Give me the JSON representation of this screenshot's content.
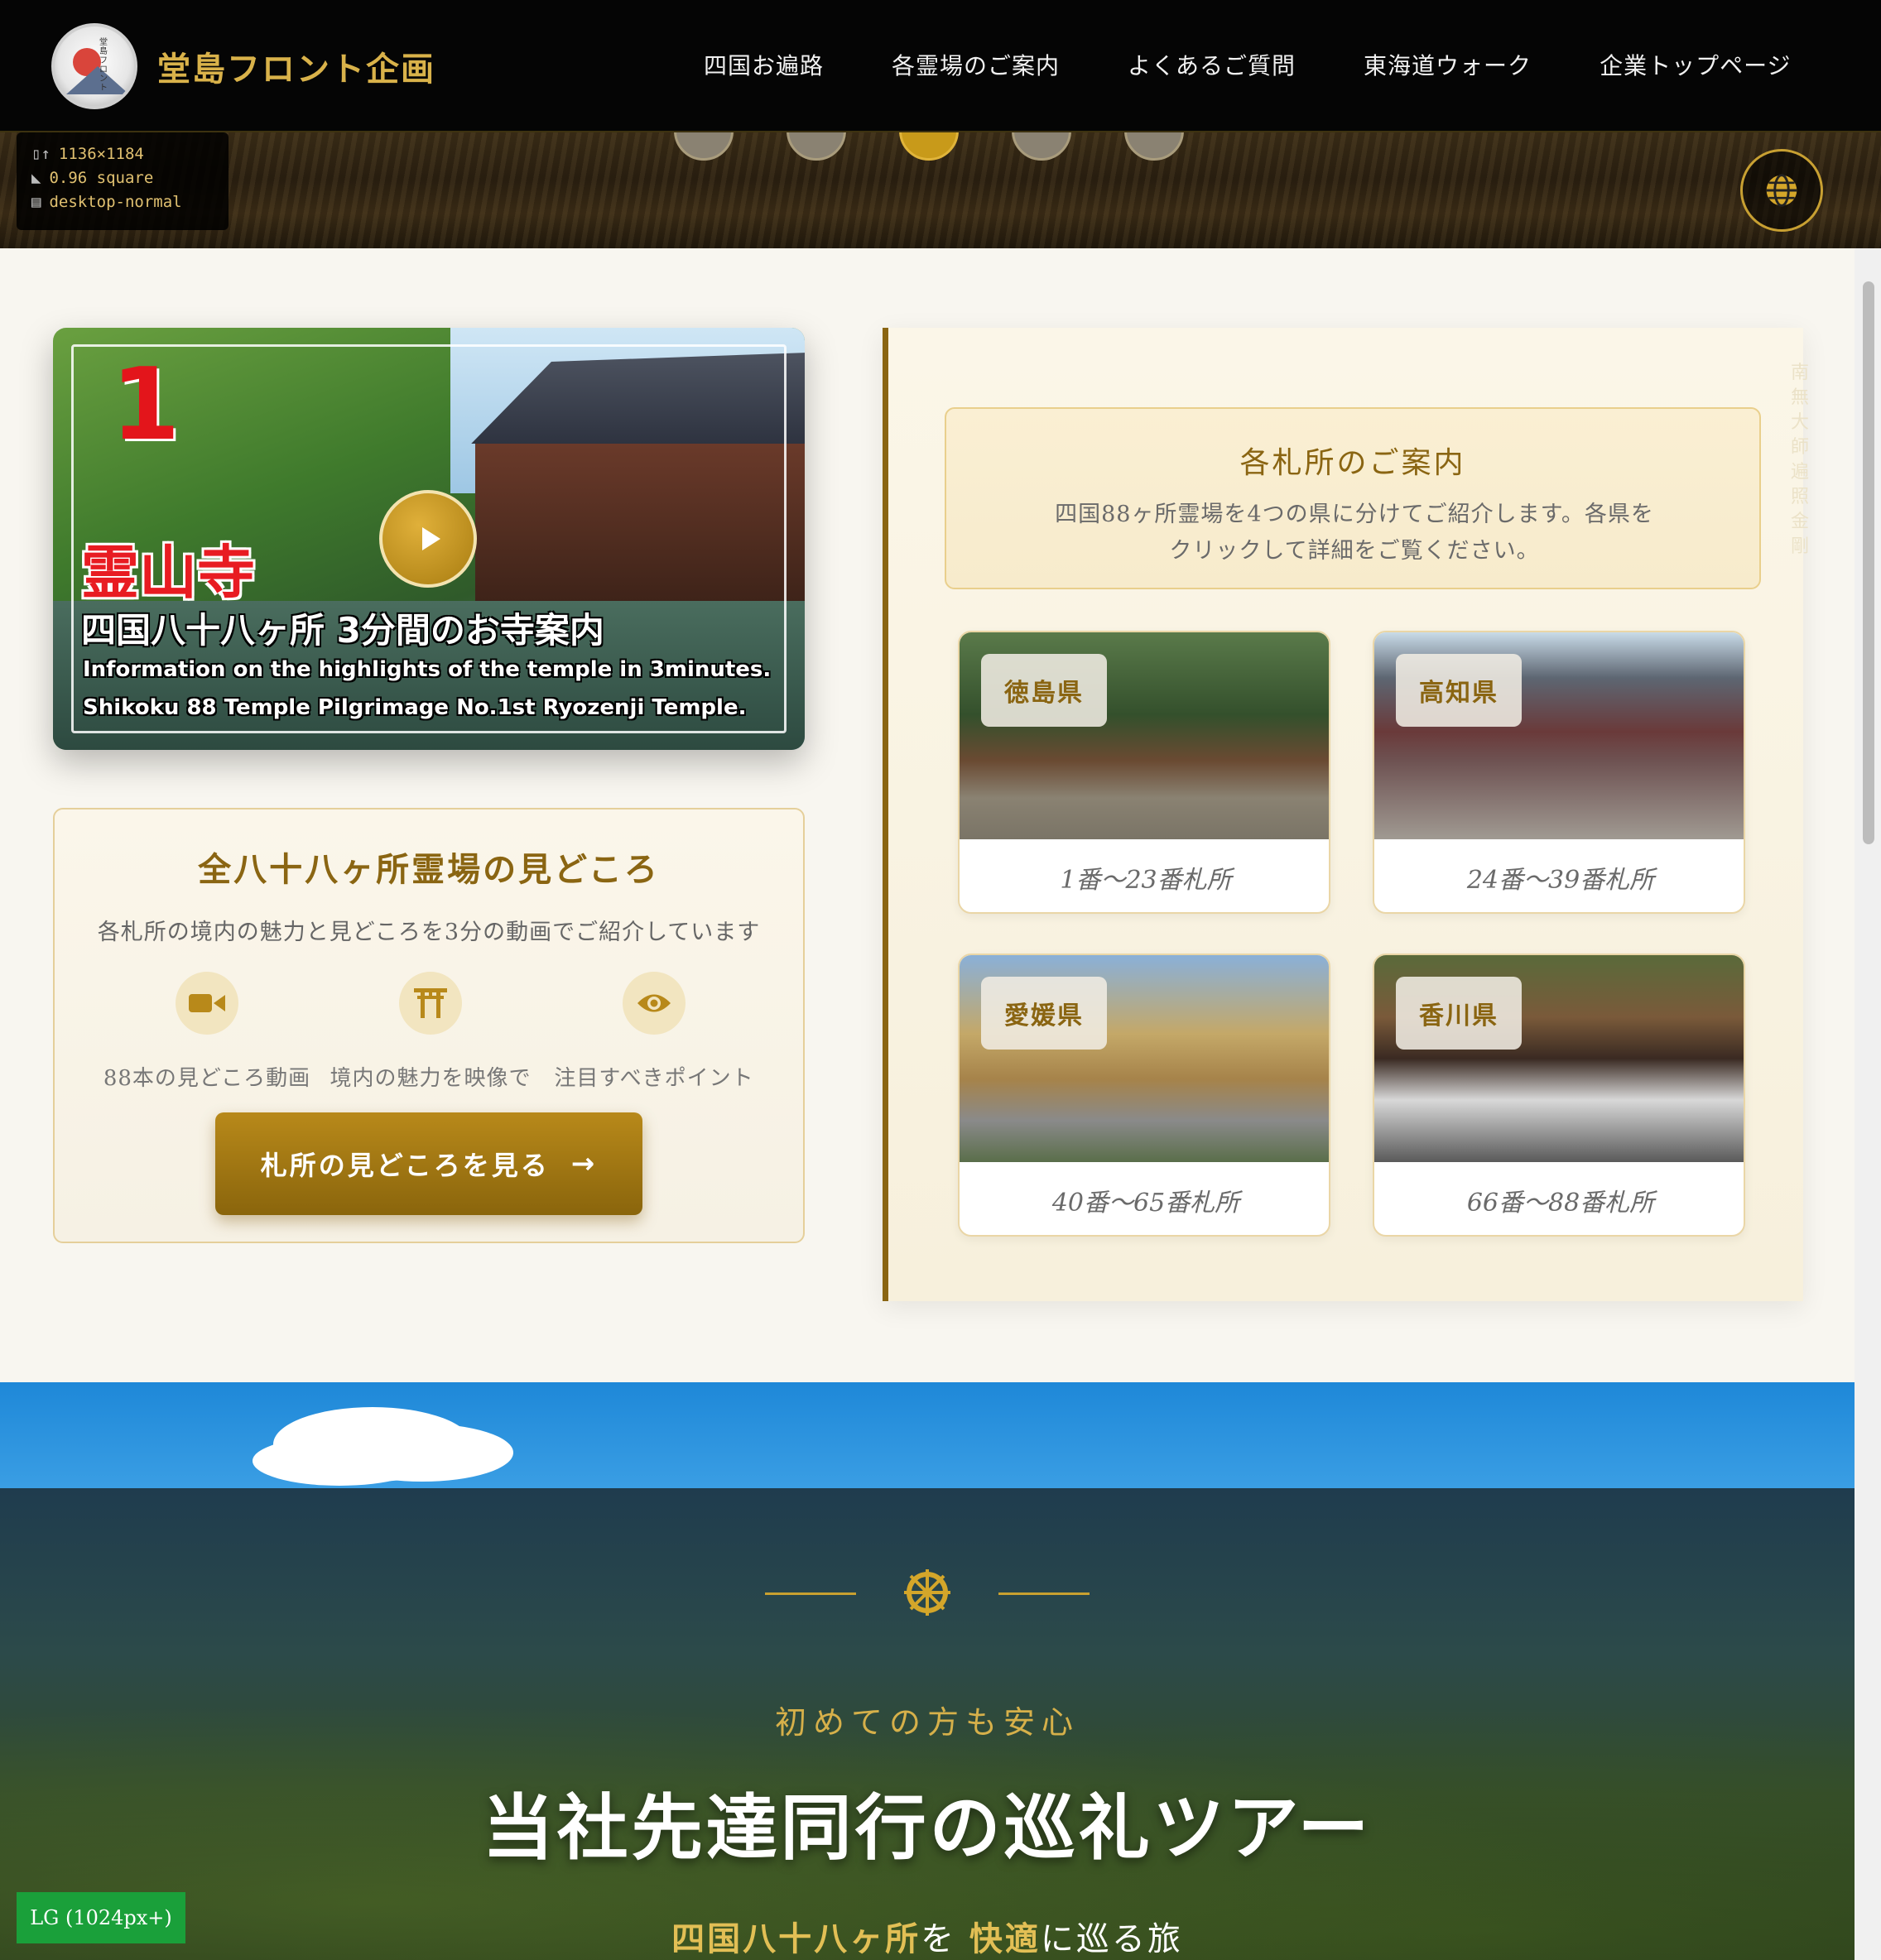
{
  "header": {
    "logo_text": "堂島フロント企画",
    "logo_vertical": "堂島フロント",
    "nav": [
      "四国お遍路",
      "各霊場のご案内",
      "よくあるご質問",
      "東海道ウォーク",
      "企業トップページ"
    ]
  },
  "viewport_badge": {
    "size": "1136×1184",
    "ratio": "0.96 square",
    "mode": "desktop-normal"
  },
  "video": {
    "number": "1",
    "temple": "霊山寺",
    "subtitle": "四国八十八ヶ所 3分間のお寺案内",
    "en_line1": "Information on the highlights of the temple in 3minutes.",
    "en_line2": "Shikoku 88 Temple Pilgrimage No.1st Ryozenji Temple."
  },
  "highlights": {
    "title": "全八十八ヶ所霊場の見どころ",
    "description": "各札所の境内の魅力と見どころを3分の動画でご紹介しています",
    "features": [
      {
        "icon": "video-camera-icon",
        "label": "88本の見どころ動画"
      },
      {
        "icon": "torii-icon",
        "label": "境内の魅力を映像で"
      },
      {
        "icon": "eye-icon",
        "label": "注目すべきポイント"
      }
    ],
    "cta_label": "札所の見どころを見る",
    "cta_arrow": "→"
  },
  "prefectures": {
    "title": "各札所のご案内",
    "description": "四国88ヶ所霊場を4つの県に分けてご紹介します。各県をクリックして詳細をご覧ください。",
    "vertical_text": "南無大師遍照金剛",
    "items": [
      {
        "name": "徳島県",
        "range": "1番～23番札所"
      },
      {
        "name": "高知県",
        "range": "24番～39番札所"
      },
      {
        "name": "愛媛県",
        "range": "40番～65番札所"
      },
      {
        "name": "香川県",
        "range": "66番～88番札所"
      }
    ]
  },
  "tour": {
    "subtitle": "初めての方も安心",
    "title": "当社先達同行の巡礼ツアー",
    "tagline_a": "四国八十八ヶ所",
    "tagline_b": "を",
    "tagline_c": "快適",
    "tagline_d": "に巡る旅"
  },
  "breakpoint_badge": "LG (1024px+)",
  "colors": {
    "gold": "#8a6512",
    "gold_light": "#d9b24a",
    "header_bg": "#050505",
    "page_bg": "#f8f6f0"
  }
}
